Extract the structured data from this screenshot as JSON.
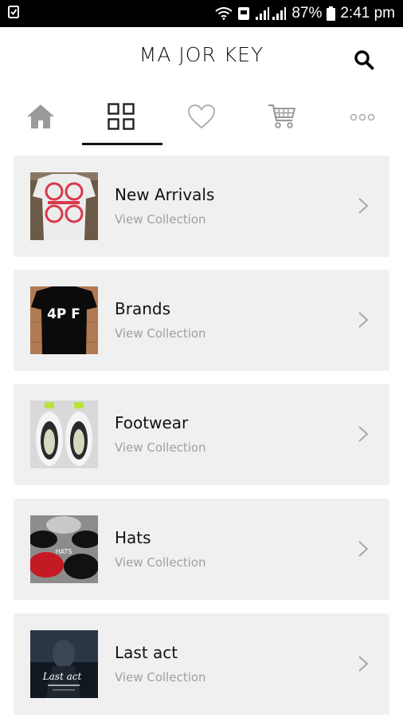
{
  "status_bar": {
    "battery": "87%",
    "time": "2:41 pm"
  },
  "header": {
    "logo": "MA JOR KEY"
  },
  "nav": {
    "tabs": [
      {
        "icon": "home-icon"
      },
      {
        "icon": "grid-icon",
        "active": true
      },
      {
        "icon": "heart-icon"
      },
      {
        "icon": "cart-icon"
      },
      {
        "icon": "more-icon"
      }
    ]
  },
  "collections": [
    {
      "title": "New Arrivals",
      "subtitle": "View Collection"
    },
    {
      "title": "Brands",
      "subtitle": "View Collection"
    },
    {
      "title": "Footwear",
      "subtitle": "View Collection"
    },
    {
      "title": "Hats",
      "subtitle": "View Collection"
    },
    {
      "title": "Last act",
      "subtitle": "View Collection"
    }
  ],
  "thumbnails": {
    "brands_print": "4P F",
    "hats_print": "HATS",
    "lastact_title": "Last act"
  },
  "colors": {
    "status_bar": "#000000",
    "card_bg": "#f0f0f0",
    "subtitle": "#a0a0a0",
    "nav_icon": "#9a9a9a",
    "accent_red": "#d8394a"
  }
}
